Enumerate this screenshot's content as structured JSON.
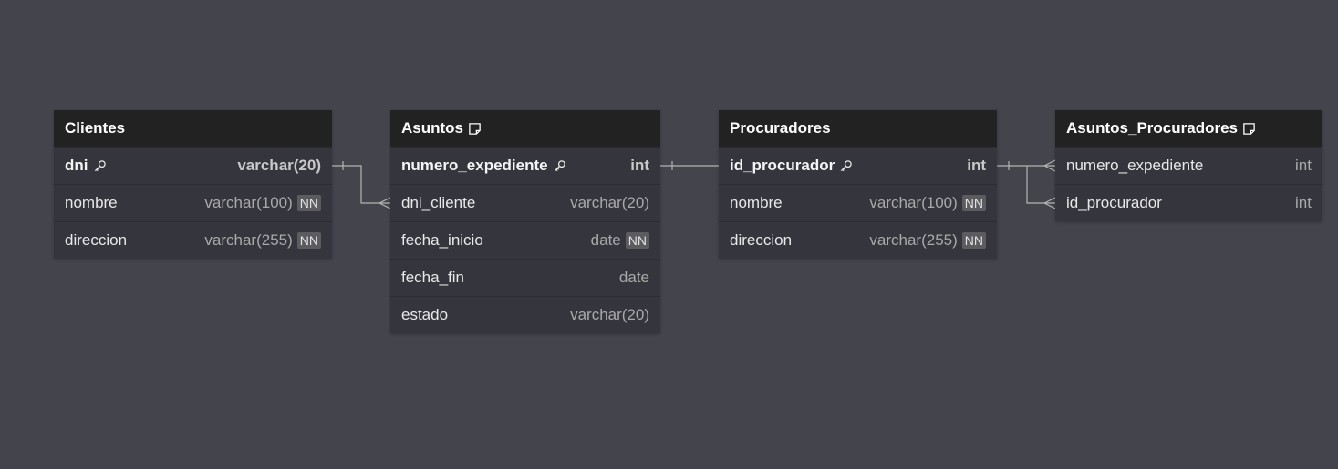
{
  "tables": [
    {
      "name": "Clientes",
      "has_note": false,
      "fields": [
        {
          "name": "dni",
          "type": "varchar(20)",
          "pk": true,
          "nn": false
        },
        {
          "name": "nombre",
          "type": "varchar(100)",
          "pk": false,
          "nn": true
        },
        {
          "name": "direccion",
          "type": "varchar(255)",
          "pk": false,
          "nn": true
        }
      ]
    },
    {
      "name": "Asuntos",
      "has_note": true,
      "fields": [
        {
          "name": "numero_expediente",
          "type": "int",
          "pk": true,
          "nn": false
        },
        {
          "name": "dni_cliente",
          "type": "varchar(20)",
          "pk": false,
          "nn": false
        },
        {
          "name": "fecha_inicio",
          "type": "date",
          "pk": false,
          "nn": true
        },
        {
          "name": "fecha_fin",
          "type": "date",
          "pk": false,
          "nn": false
        },
        {
          "name": "estado",
          "type": "varchar(20)",
          "pk": false,
          "nn": false
        }
      ]
    },
    {
      "name": "Procuradores",
      "has_note": false,
      "fields": [
        {
          "name": "id_procurador",
          "type": "int",
          "pk": true,
          "nn": false
        },
        {
          "name": "nombre",
          "type": "varchar(100)",
          "pk": false,
          "nn": true
        },
        {
          "name": "direccion",
          "type": "varchar(255)",
          "pk": false,
          "nn": true
        }
      ]
    },
    {
      "name": "Asuntos_Procuradores",
      "has_note": true,
      "fields": [
        {
          "name": "numero_expediente",
          "type": "int",
          "pk": false,
          "nn": false
        },
        {
          "name": "id_procurador",
          "type": "int",
          "pk": false,
          "nn": false
        }
      ]
    }
  ],
  "nn_label": "NN",
  "relationships": [
    {
      "from": "Clientes.dni",
      "to": "Asuntos.dni_cliente",
      "cardinality": "one-to-many"
    },
    {
      "from": "Asuntos.numero_expediente",
      "to": "Procuradores.id_procurador",
      "cardinality": "one-to-one"
    },
    {
      "from": "Procuradores.id_procurador",
      "to": "Asuntos_Procuradores.numero_expediente",
      "cardinality": "one-to-many"
    },
    {
      "from": "Procuradores.id_procurador",
      "to": "Asuntos_Procuradores.id_procurador",
      "cardinality": "one-to-many"
    }
  ],
  "colors": {
    "canvas": "#44444d",
    "header": "#222222",
    "body": "#35353d",
    "link": "#b4b4b4"
  },
  "icons": {
    "key": "key-icon",
    "note": "note-icon"
  }
}
